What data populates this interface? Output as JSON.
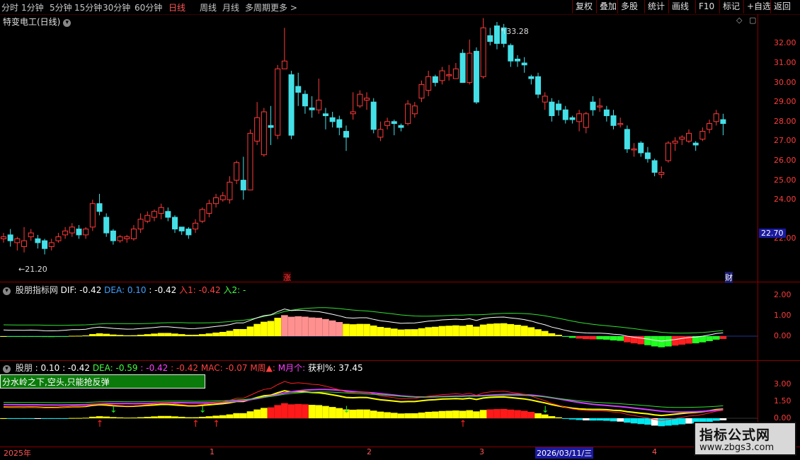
{
  "toolbar": {
    "periods": [
      "分时",
      "1分钟",
      "5分钟",
      "15分钟",
      "30分钟",
      "60分钟",
      "日线",
      "周线",
      "月线",
      "多周期",
      "更多 >"
    ],
    "active_period": "日线",
    "right_buttons": [
      "复权",
      "叠加",
      "多股",
      "统计",
      "画线",
      "F10",
      "标记",
      "+自选",
      "返回"
    ]
  },
  "stock": {
    "title": "特变电工(日线)"
  },
  "main_panel": {
    "y_ticks": [
      "32.00",
      "31.00",
      "30.00",
      "29.00",
      "28.00",
      "27.00",
      "26.00",
      "25.00",
      "24.00",
      "22.00"
    ],
    "high_label": "33.28",
    "low_label": "21.20",
    "current_price": "22.70",
    "marker_zhang": "涨",
    "marker_cai": "财"
  },
  "ind1": {
    "name": "股朋指标网",
    "dif_label": "DIF: -0.42",
    "dea_label": "DEA: 0.10",
    "extra_label": ": -0.42",
    "in1_label": "入1: -0.42",
    "in2_label": "入2: -",
    "y_ticks": [
      "2.00",
      "1.00",
      "0.00"
    ]
  },
  "ind2": {
    "name": "股朋",
    "v1": ": 0.10",
    "v2": ": -0.42",
    "dea": "DEA: -0.59",
    "v3": ": -0.42",
    "v4": ": -0.42",
    "mac": "MAC: -0.07",
    "week": "M周▲:",
    "month": "M月个:",
    "profit": "获利%: 37.45",
    "warning": "分水岭之下,空头,只能抢反弹",
    "y_ticks": [
      "3.00",
      "1.50",
      "0.00"
    ]
  },
  "x_axis": {
    "labels": [
      "2025年",
      "1",
      "2",
      "3",
      "2026/03/11/三",
      "4"
    ]
  },
  "watermark": {
    "title": "指标公式网",
    "url": "www.zbgs3.com"
  },
  "chart_data": {
    "type": "candlestick",
    "title": "特变电工(日线)",
    "ylim": [
      21,
      33.5
    ],
    "candles": [
      [
        22.0,
        22.1,
        21.8,
        22.3
      ],
      [
        22.2,
        21.9,
        21.6,
        22.5
      ],
      [
        21.8,
        22.0,
        21.4,
        22.1
      ],
      [
        21.6,
        21.9,
        21.3,
        22.6
      ],
      [
        22.1,
        22.3,
        21.9,
        22.5
      ],
      [
        22.0,
        21.8,
        21.5,
        22.2
      ],
      [
        21.9,
        21.5,
        21.2,
        22.0
      ],
      [
        21.6,
        21.8,
        21.4,
        22.0
      ],
      [
        21.9,
        22.1,
        21.8,
        22.3
      ],
      [
        22.2,
        22.4,
        22.0,
        22.6
      ],
      [
        22.3,
        22.6,
        22.1,
        22.8
      ],
      [
        22.5,
        22.2,
        22.0,
        22.7
      ],
      [
        22.2,
        22.5,
        22.0,
        22.6
      ],
      [
        22.6,
        23.8,
        22.4,
        24.0
      ],
      [
        23.8,
        23.4,
        23.2,
        24.3
      ],
      [
        23.1,
        22.3,
        22.1,
        23.3
      ],
      [
        22.4,
        21.9,
        21.7,
        22.5
      ],
      [
        21.9,
        22.1,
        21.8,
        22.2
      ],
      [
        22.0,
        22.1,
        21.8,
        22.2
      ],
      [
        22.0,
        22.5,
        21.9,
        22.7
      ],
      [
        22.5,
        23.0,
        22.3,
        23.3
      ],
      [
        22.9,
        23.2,
        22.8,
        23.4
      ],
      [
        23.1,
        23.4,
        22.9,
        23.5
      ],
      [
        23.3,
        23.6,
        23.0,
        23.8
      ],
      [
        23.4,
        23.1,
        22.9,
        23.6
      ],
      [
        23.1,
        22.5,
        22.3,
        23.2
      ],
      [
        22.6,
        22.4,
        22.2,
        22.6
      ],
      [
        22.5,
        22.2,
        22.0,
        22.6
      ],
      [
        22.5,
        22.8,
        22.3,
        23.0
      ],
      [
        22.9,
        23.5,
        22.8,
        23.6
      ],
      [
        23.3,
        23.8,
        23.1,
        24.0
      ],
      [
        23.8,
        24.1,
        23.6,
        24.3
      ],
      [
        24.0,
        24.2,
        23.9,
        24.4
      ],
      [
        24.0,
        24.9,
        23.8,
        25.2
      ],
      [
        25.0,
        25.9,
        24.8,
        26.0
      ],
      [
        25.0,
        24.5,
        24.0,
        26.2
      ],
      [
        24.5,
        27.4,
        24.5,
        27.6
      ],
      [
        27.0,
        28.2,
        26.8,
        29.0
      ],
      [
        26.3,
        28.5,
        26.2,
        28.7
      ],
      [
        27.8,
        27.7,
        26.8,
        28.8
      ],
      [
        27.3,
        30.7,
        27.1,
        30.9
      ],
      [
        30.7,
        31.1,
        30.9,
        32.8
      ],
      [
        30.4,
        27.3,
        27.1,
        30.6
      ],
      [
        29.8,
        29.5,
        28.8,
        30.5
      ],
      [
        29.4,
        28.8,
        28.4,
        29.6
      ],
      [
        28.7,
        28.6,
        28.2,
        29.3
      ],
      [
        28.6,
        29.1,
        28.4,
        30.2
      ],
      [
        28.4,
        28.3,
        27.6,
        28.7
      ],
      [
        28.2,
        28.0,
        27.7,
        28.5
      ],
      [
        28.1,
        27.7,
        27.3,
        28.3
      ],
      [
        27.5,
        27.2,
        26.5,
        27.8
      ],
      [
        28.4,
        28.5,
        28.1,
        29.5
      ],
      [
        28.8,
        29.4,
        28.7,
        29.6
      ],
      [
        29.1,
        29.2,
        28.6,
        29.5
      ],
      [
        29.0,
        27.6,
        27.4,
        29.2
      ],
      [
        27.2,
        27.6,
        27.0,
        28.0
      ],
      [
        27.8,
        28.0,
        27.6,
        28.2
      ],
      [
        28.0,
        27.9,
        27.3,
        28.1
      ],
      [
        27.8,
        27.7,
        27.5,
        27.9
      ],
      [
        27.9,
        28.9,
        27.8,
        29.1
      ],
      [
        28.4,
        28.8,
        28.2,
        29.0
      ],
      [
        29.2,
        29.9,
        29.0,
        30.1
      ],
      [
        29.6,
        30.3,
        29.3,
        30.6
      ],
      [
        30.3,
        30.0,
        29.8,
        30.4
      ],
      [
        30.1,
        30.6,
        29.9,
        30.8
      ],
      [
        30.4,
        30.4,
        30.1,
        30.9
      ],
      [
        30.2,
        30.7,
        30.2,
        31.0
      ],
      [
        31.5,
        30.0,
        30.0,
        31.7
      ],
      [
        30.0,
        31.5,
        29.9,
        32.2
      ],
      [
        31.6,
        29.0,
        28.9,
        31.8
      ],
      [
        30.3,
        32.8,
        30.2,
        33.3
      ],
      [
        32.4,
        32.1,
        31.9,
        32.8
      ],
      [
        32.9,
        32.0,
        31.7,
        33.1
      ],
      [
        32.8,
        32.0,
        31.8,
        33.0
      ],
      [
        31.9,
        31.1,
        30.8,
        32.0
      ],
      [
        31.2,
        31.1,
        30.8,
        31.4
      ],
      [
        31.0,
        30.9,
        30.5,
        31.3
      ],
      [
        30.3,
        30.2,
        29.9,
        30.4
      ],
      [
        30.3,
        29.4,
        29.2,
        30.5
      ],
      [
        29.0,
        29.3,
        28.6,
        29.5
      ],
      [
        29.0,
        28.3,
        28.0,
        29.2
      ],
      [
        28.9,
        28.6,
        28.3,
        29.1
      ],
      [
        28.6,
        28.1,
        27.9,
        28.8
      ],
      [
        28.2,
        28.1,
        27.9,
        28.3
      ],
      [
        28.0,
        28.4,
        27.5,
        28.6
      ],
      [
        27.7,
        28.4,
        27.4,
        28.5
      ],
      [
        29.0,
        28.6,
        28.3,
        29.3
      ],
      [
        28.8,
        28.8,
        28.5,
        29.2
      ],
      [
        28.6,
        28.3,
        28.0,
        28.8
      ],
      [
        28.3,
        27.8,
        27.6,
        28.6
      ],
      [
        27.9,
        27.9,
        27.7,
        28.2
      ],
      [
        27.6,
        26.6,
        26.4,
        27.8
      ],
      [
        26.6,
        26.6,
        26.2,
        26.9
      ],
      [
        26.9,
        26.4,
        26.2,
        27.0
      ],
      [
        26.4,
        26.1,
        25.9,
        26.7
      ],
      [
        26.0,
        25.4,
        25.2,
        26.1
      ],
      [
        25.3,
        25.4,
        25.1,
        25.7
      ],
      [
        26.0,
        26.9,
        25.9,
        27.0
      ],
      [
        26.9,
        27.0,
        26.5,
        27.2
      ],
      [
        27.1,
        27.2,
        26.8,
        27.3
      ],
      [
        27.0,
        27.4,
        26.9,
        27.6
      ],
      [
        26.9,
        26.8,
        26.5,
        27.0
      ],
      [
        27.1,
        27.5,
        27.0,
        27.7
      ],
      [
        27.6,
        27.9,
        27.4,
        28.1
      ],
      [
        28.0,
        28.4,
        27.8,
        28.6
      ],
      [
        28.1,
        27.9,
        27.3,
        28.4
      ]
    ]
  }
}
